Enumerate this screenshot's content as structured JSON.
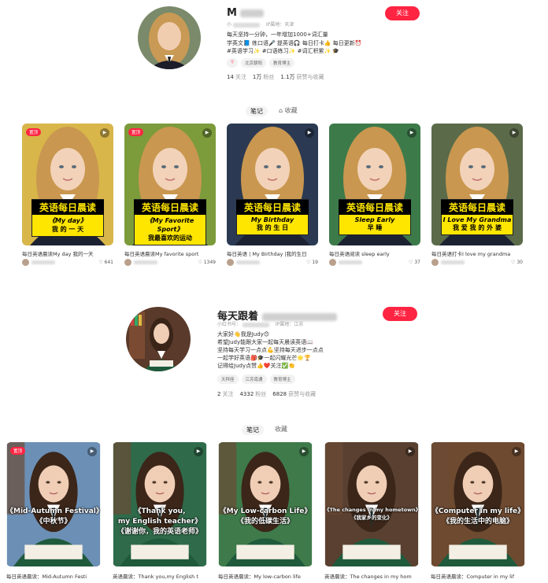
{
  "profiles": [
    {
      "name": "M",
      "id_prefix": "小",
      "ip": "IP属地：天津",
      "bio": [
        "每天坚持一分钟，一年增加1000+词汇量",
        "学英文📘 练口语🎤 提英语🎧 每日打卡👍 每日更新⏰",
        "#英语学习✨ #口语练习✨ #词汇积累✨ 🎓"
      ],
      "tags": [
        {
          "text": "♀",
          "sym": true
        },
        {
          "text": "北京朝阳",
          "sym": false
        },
        {
          "text": "教育博主",
          "sym": false
        }
      ],
      "stats": [
        {
          "value": "14",
          "label": "关注"
        },
        {
          "value": "1万",
          "label": "粉丝"
        },
        {
          "value": "1.1万",
          "label": "获赞与收藏"
        }
      ],
      "follow_label": "关注",
      "tabs": {
        "notes": "笔记",
        "collect": "收藏"
      }
    },
    {
      "name": "每天跟着",
      "id_prefix": "小红书号：",
      "ip": "IP属地：江苏",
      "bio": [
        "大家好👋我是Judy😊",
        "希望Judy能跟大家一起每天晨读英语📖",
        "坚持每天学习一点点💪坚持每天进步一点点",
        "一起学好英语🎒🎓一起闪耀光芒🌟🏆",
        "记得给Judy点赞👍❤️关注✅👏"
      ],
      "tags": [
        {
          "text": "天秤座",
          "sym": false
        },
        {
          "text": "江苏南通",
          "sym": false
        },
        {
          "text": "教育博主",
          "sym": false
        }
      ],
      "stats": [
        {
          "value": "2",
          "label": "关注"
        },
        {
          "value": "4332",
          "label": "粉丝"
        },
        {
          "value": "6828",
          "label": "获赞与收藏"
        }
      ],
      "follow_label": "关注",
      "tabs": {
        "notes": "笔记",
        "collect": "收藏"
      }
    }
  ],
  "feed1": [
    {
      "badge": "置顶",
      "headline": "英语每日晨读",
      "book": "《My day》",
      "cn": "我 的 一 天",
      "title": "每日英语晨读My day 我的一天",
      "likes": "641"
    },
    {
      "badge": "置顶",
      "headline": "英语每日晨读",
      "book": "《My Favorite Sport》",
      "cn": "我最喜欢的运动",
      "title": "每日英语晨读My favorite sport",
      "likes": "1349"
    },
    {
      "badge": "",
      "headline": "英语每日晨读",
      "book": "My Birthday",
      "cn": "我 的 生 日",
      "title": "每日英语 | My Birthday |我的生日",
      "likes": "19"
    },
    {
      "badge": "",
      "headline": "英语每日晨读",
      "book": "Sleep Early",
      "cn": "早 睡",
      "title": "每日英语阅读 sleep early",
      "likes": "37"
    },
    {
      "badge": "",
      "headline": "英语每日晨读",
      "book": "I Love My Grandma",
      "cn": "我 爱 我 的 外 婆",
      "title": "每日英语打卡I love my grandma",
      "likes": "30"
    }
  ],
  "feed2": [
    {
      "badge": "置顶",
      "line1": "《Mid-Autumn Festival》",
      "line2": "《中秋节》",
      "line3": "",
      "title": "每日英语晨读：Mid-Autumn Festi"
    },
    {
      "badge": "",
      "line1": "《Thank you,",
      "line2": "my English teacher》",
      "line3": "《谢谢你，我的英语老师》",
      "title": "英语晨读：Thank you,my English t"
    },
    {
      "badge": "",
      "line1": "《My Low-carbon Life》",
      "line2": "《我的低碳生活》",
      "line3": "",
      "title": "每日英语晨读：My low-carbon life"
    },
    {
      "badge": "",
      "line1": "《The changes in my hometown》",
      "line2": "《我家乡的变化》",
      "line3": "",
      "title": "英语晨读：The changes in my hom"
    },
    {
      "badge": "",
      "line1": "《Computer in my life》",
      "line2": "《我的生活中的电脑》",
      "line3": "",
      "title": "每日英语晨读：Computer in my lif"
    }
  ],
  "colors": {
    "accent": "#ff2442",
    "yellow": "#ffe600",
    "uniform_green": "#1f5a3c"
  },
  "icons": {
    "play": "▶",
    "heart": "♡",
    "collect": "⌂"
  }
}
